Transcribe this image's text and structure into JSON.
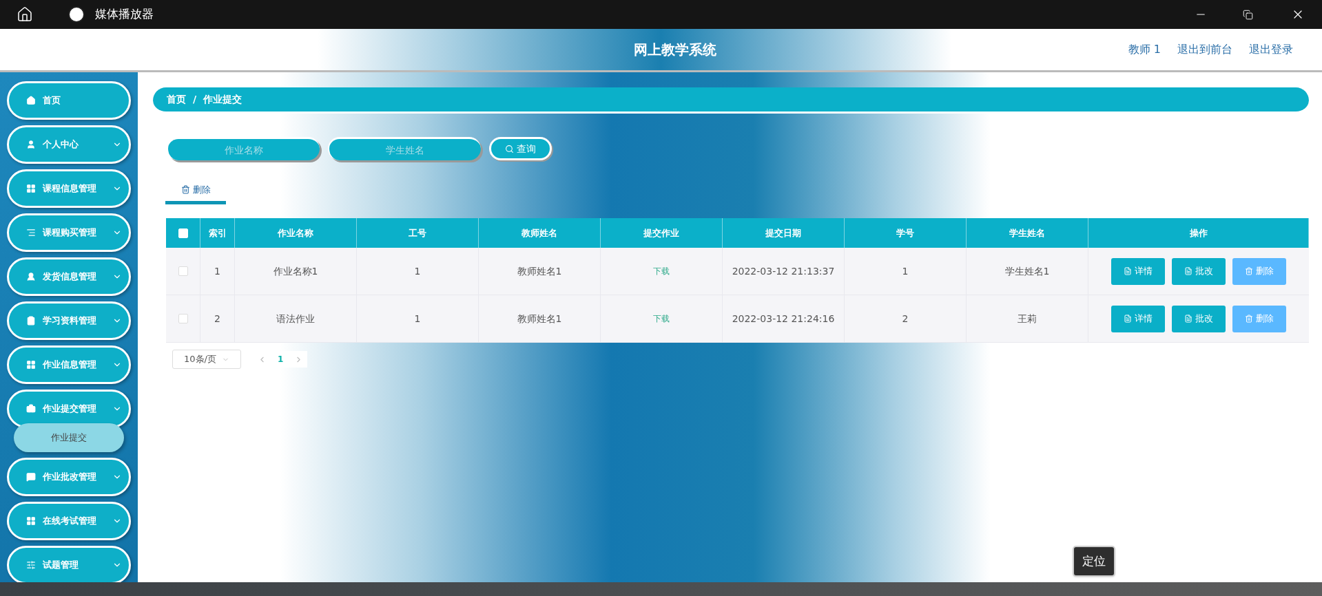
{
  "titlebar": {
    "app_title": "媒体播放器"
  },
  "header": {
    "title": "网上教学系统",
    "links": [
      "教师 1",
      "退出到前台",
      "退出登录"
    ]
  },
  "sidebar": {
    "items": [
      {
        "label": "首页",
        "kind": "home"
      },
      {
        "label": "个人中心",
        "kind": "user",
        "has_submenu": true
      },
      {
        "label": "课程信息管理",
        "kind": "grid",
        "has_submenu": true
      },
      {
        "label": "课程购买管理",
        "kind": "list",
        "has_submenu": true
      },
      {
        "label": "发货信息管理",
        "kind": "person",
        "has_submenu": true
      },
      {
        "label": "学习资料管理",
        "kind": "clipboard",
        "has_submenu": true
      },
      {
        "label": "作业信息管理",
        "kind": "grid",
        "has_submenu": true
      },
      {
        "label": "作业提交管理",
        "kind": "briefcase",
        "has_submenu": true,
        "expanded": true,
        "children": [
          {
            "label": "作业提交",
            "selected": true
          }
        ]
      },
      {
        "label": "作业批改管理",
        "kind": "chat",
        "has_submenu": true
      },
      {
        "label": "在线考试管理",
        "kind": "grid",
        "has_submenu": true
      },
      {
        "label": "试题管理",
        "kind": "sliders",
        "has_submenu": true
      }
    ]
  },
  "breadcrumb": {
    "items": [
      "首页",
      "作业提交"
    ],
    "separator": "/"
  },
  "search": {
    "fields": [
      {
        "placeholder": "作业名称"
      },
      {
        "placeholder": "学生姓名"
      }
    ],
    "button": "查询"
  },
  "toolbar": {
    "delete_tab": {
      "label": "删除",
      "selected": true
    }
  },
  "table": {
    "select_all_checked": false,
    "columns": [
      "索引",
      "作业名称",
      "工号",
      "教师姓名",
      "提交作业",
      "提交日期",
      "学号",
      "学生姓名",
      "操作"
    ],
    "rows": [
      {
        "checked": false,
        "cells": [
          "1",
          "作业名称1",
          "1",
          "教师姓名1",
          "下载",
          "2022-03-12 21:13:37",
          "1",
          "学生姓名1"
        ],
        "actions": [
          {
            "label": "详情",
            "kind": "primary"
          },
          {
            "label": "批改",
            "kind": "primary"
          },
          {
            "label": "删除",
            "kind": "danger"
          }
        ]
      },
      {
        "checked": false,
        "cells": [
          "2",
          "语法作业",
          "1",
          "教师姓名1",
          "下载",
          "2022-03-12 21:24:16",
          "2",
          "王莉"
        ],
        "actions": [
          {
            "label": "详情",
            "kind": "primary"
          },
          {
            "label": "批改",
            "kind": "primary"
          },
          {
            "label": "删除",
            "kind": "danger"
          }
        ]
      }
    ]
  },
  "pagination": {
    "page_size": "10条/页",
    "pages": [
      {
        "label": "1",
        "selected": true
      }
    ]
  },
  "tooltip": "定位"
}
